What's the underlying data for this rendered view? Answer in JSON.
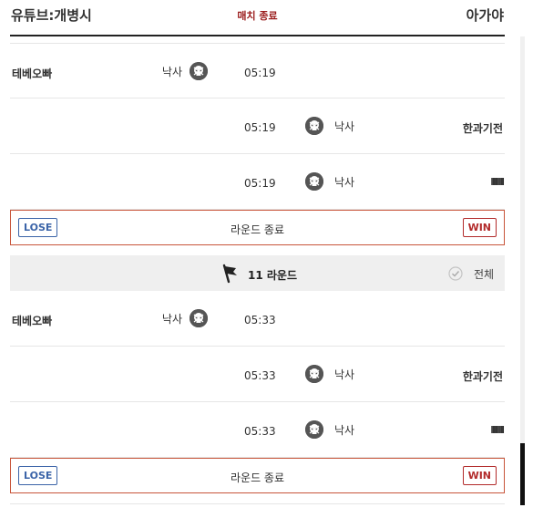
{
  "header": {
    "team_left": "유튜브:개병시",
    "status": "매치 종료",
    "team_right": "아가야"
  },
  "rounds": [
    {
      "events": [
        {
          "player_left": "테베오빠",
          "action_left": "낙사",
          "time": "05:19",
          "action_right": "",
          "player_right": ""
        },
        {
          "player_left": "",
          "action_left": "",
          "time": "05:19",
          "action_right": "낙사",
          "player_right": "한과기전"
        },
        {
          "player_left": "",
          "action_left": "",
          "time": "05:19",
          "action_right": "낙사",
          "player_right": "lllllllllllll"
        }
      ],
      "end": {
        "left_badge": "LOSE",
        "label": "라운드 종료",
        "right_badge": "WIN"
      }
    },
    {
      "header": {
        "round_label": "11 라운드",
        "filter_label": "전체"
      },
      "events": [
        {
          "player_left": "테베오빠",
          "action_left": "낙사",
          "time": "05:33",
          "action_right": "",
          "player_right": ""
        },
        {
          "player_left": "",
          "action_left": "",
          "time": "05:33",
          "action_right": "낙사",
          "player_right": "한과기전"
        },
        {
          "player_left": "",
          "action_left": "",
          "time": "05:33",
          "action_right": "낙사",
          "player_right": "lllllllllllll"
        }
      ],
      "end": {
        "left_badge": "LOSE",
        "label": "라운드 종료",
        "right_badge": "WIN"
      }
    }
  ],
  "colors": {
    "lose": "#3b64a8",
    "win": "#b22a2a",
    "round_border": "#c8553a",
    "status": "#9b1c1c"
  },
  "icons": {
    "kill": "skull-icon",
    "round_start": "flag-icon",
    "filter": "check-circle-icon"
  }
}
